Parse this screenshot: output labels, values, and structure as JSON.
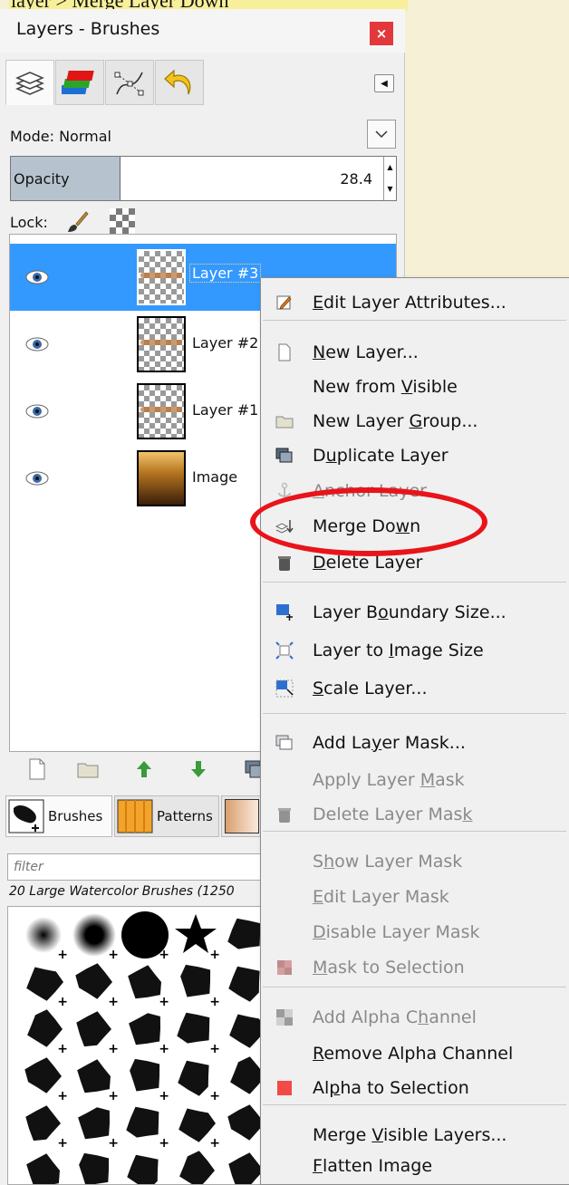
{
  "caption": "layer > Merge Layer Down",
  "dock": {
    "title": "Layers - Brushes",
    "close_label": "×",
    "tab_icons": [
      "layers-tab-icon",
      "channels-tab-icon",
      "paths-tab-icon",
      "undo-history-tab-icon"
    ],
    "mode_label": "Mode: Normal",
    "opacity_label": "Opacity",
    "opacity_value": "28.4",
    "opacity_fraction": 0.284,
    "lock_label": "Lock:"
  },
  "layers": [
    {
      "name": "Layer #3",
      "selected": true
    },
    {
      "name": "Layer #2",
      "selected": false
    },
    {
      "name": "Layer #1",
      "selected": false
    },
    {
      "name": "Image",
      "selected": false
    }
  ],
  "brushes_panel": {
    "tabs": [
      {
        "label": "Brushes"
      },
      {
        "label": "Patterns"
      }
    ],
    "filter_placeholder": "filter",
    "brush_set_name": "20 Large Watercolor Brushes (1250"
  },
  "context_menu": {
    "items": [
      {
        "pre": "",
        "u": "E",
        "post": "dit Layer Attributes...",
        "disabled": false,
        "icon": "edit-attributes-icon"
      },
      {
        "pre": "",
        "u": "N",
        "post": "ew Layer...",
        "disabled": false,
        "icon": "new-layer-icon"
      },
      {
        "pre": "New from ",
        "u": "V",
        "post": "isible",
        "disabled": false,
        "icon": ""
      },
      {
        "pre": "New Layer ",
        "u": "G",
        "post": "roup...",
        "disabled": false,
        "icon": "new-layer-group-icon"
      },
      {
        "pre": "D",
        "u": "u",
        "post": "plicate Layer",
        "disabled": false,
        "icon": "duplicate-layer-icon"
      },
      {
        "pre": "",
        "u": "A",
        "post": "nchor Layer",
        "disabled": true,
        "icon": "anchor-layer-icon"
      },
      {
        "pre": "Merge Do",
        "u": "w",
        "post": "n",
        "disabled": false,
        "icon": "merge-down-icon"
      },
      {
        "pre": "",
        "u": "D",
        "post": "elete Layer",
        "disabled": false,
        "icon": "delete-layer-icon"
      },
      {
        "pre": "Layer B",
        "u": "o",
        "post": "undary Size...",
        "disabled": false,
        "icon": "layer-boundary-size-icon"
      },
      {
        "pre": "Layer to ",
        "u": "I",
        "post": "mage Size",
        "disabled": false,
        "icon": "layer-to-image-size-icon"
      },
      {
        "pre": "",
        "u": "S",
        "post": "cale Layer...",
        "disabled": false,
        "icon": "scale-layer-icon"
      },
      {
        "pre": "Add La",
        "u": "y",
        "post": "er Mask...",
        "disabled": false,
        "icon": "add-layer-mask-icon"
      },
      {
        "pre": "Apply Layer ",
        "u": "M",
        "post": "ask",
        "disabled": true,
        "icon": ""
      },
      {
        "pre": "Delete Layer Mas",
        "u": "k",
        "post": "",
        "disabled": true,
        "icon": "delete-layer-mask-icon"
      },
      {
        "pre": "S",
        "u": "h",
        "post": "ow Layer Mask",
        "disabled": true,
        "icon": ""
      },
      {
        "pre": "",
        "u": "E",
        "post": "dit Layer Mask",
        "disabled": true,
        "icon": ""
      },
      {
        "pre": "",
        "u": "D",
        "post": "isable Layer Mask",
        "disabled": true,
        "icon": ""
      },
      {
        "pre": "",
        "u": "M",
        "post": "ask to Selection",
        "disabled": true,
        "icon": "mask-to-selection-icon"
      },
      {
        "pre": "Add Alpha C",
        "u": "h",
        "post": "annel",
        "disabled": true,
        "icon": "add-alpha-channel-icon"
      },
      {
        "pre": "",
        "u": "R",
        "post": "emove Alpha Channel",
        "disabled": false,
        "icon": ""
      },
      {
        "pre": "Al",
        "u": "p",
        "post": "ha to Selection",
        "disabled": false,
        "icon": "alpha-to-selection-icon"
      },
      {
        "pre": "Merge ",
        "u": "V",
        "post": "isible Layers...",
        "disabled": false,
        "icon": ""
      },
      {
        "pre": "",
        "u": "F",
        "post": "latten Image",
        "disabled": false,
        "icon": ""
      }
    ]
  },
  "colors": {
    "selection": "#3399ff",
    "highlight_ring": "#e8141a",
    "close_button": "#e2383b"
  }
}
